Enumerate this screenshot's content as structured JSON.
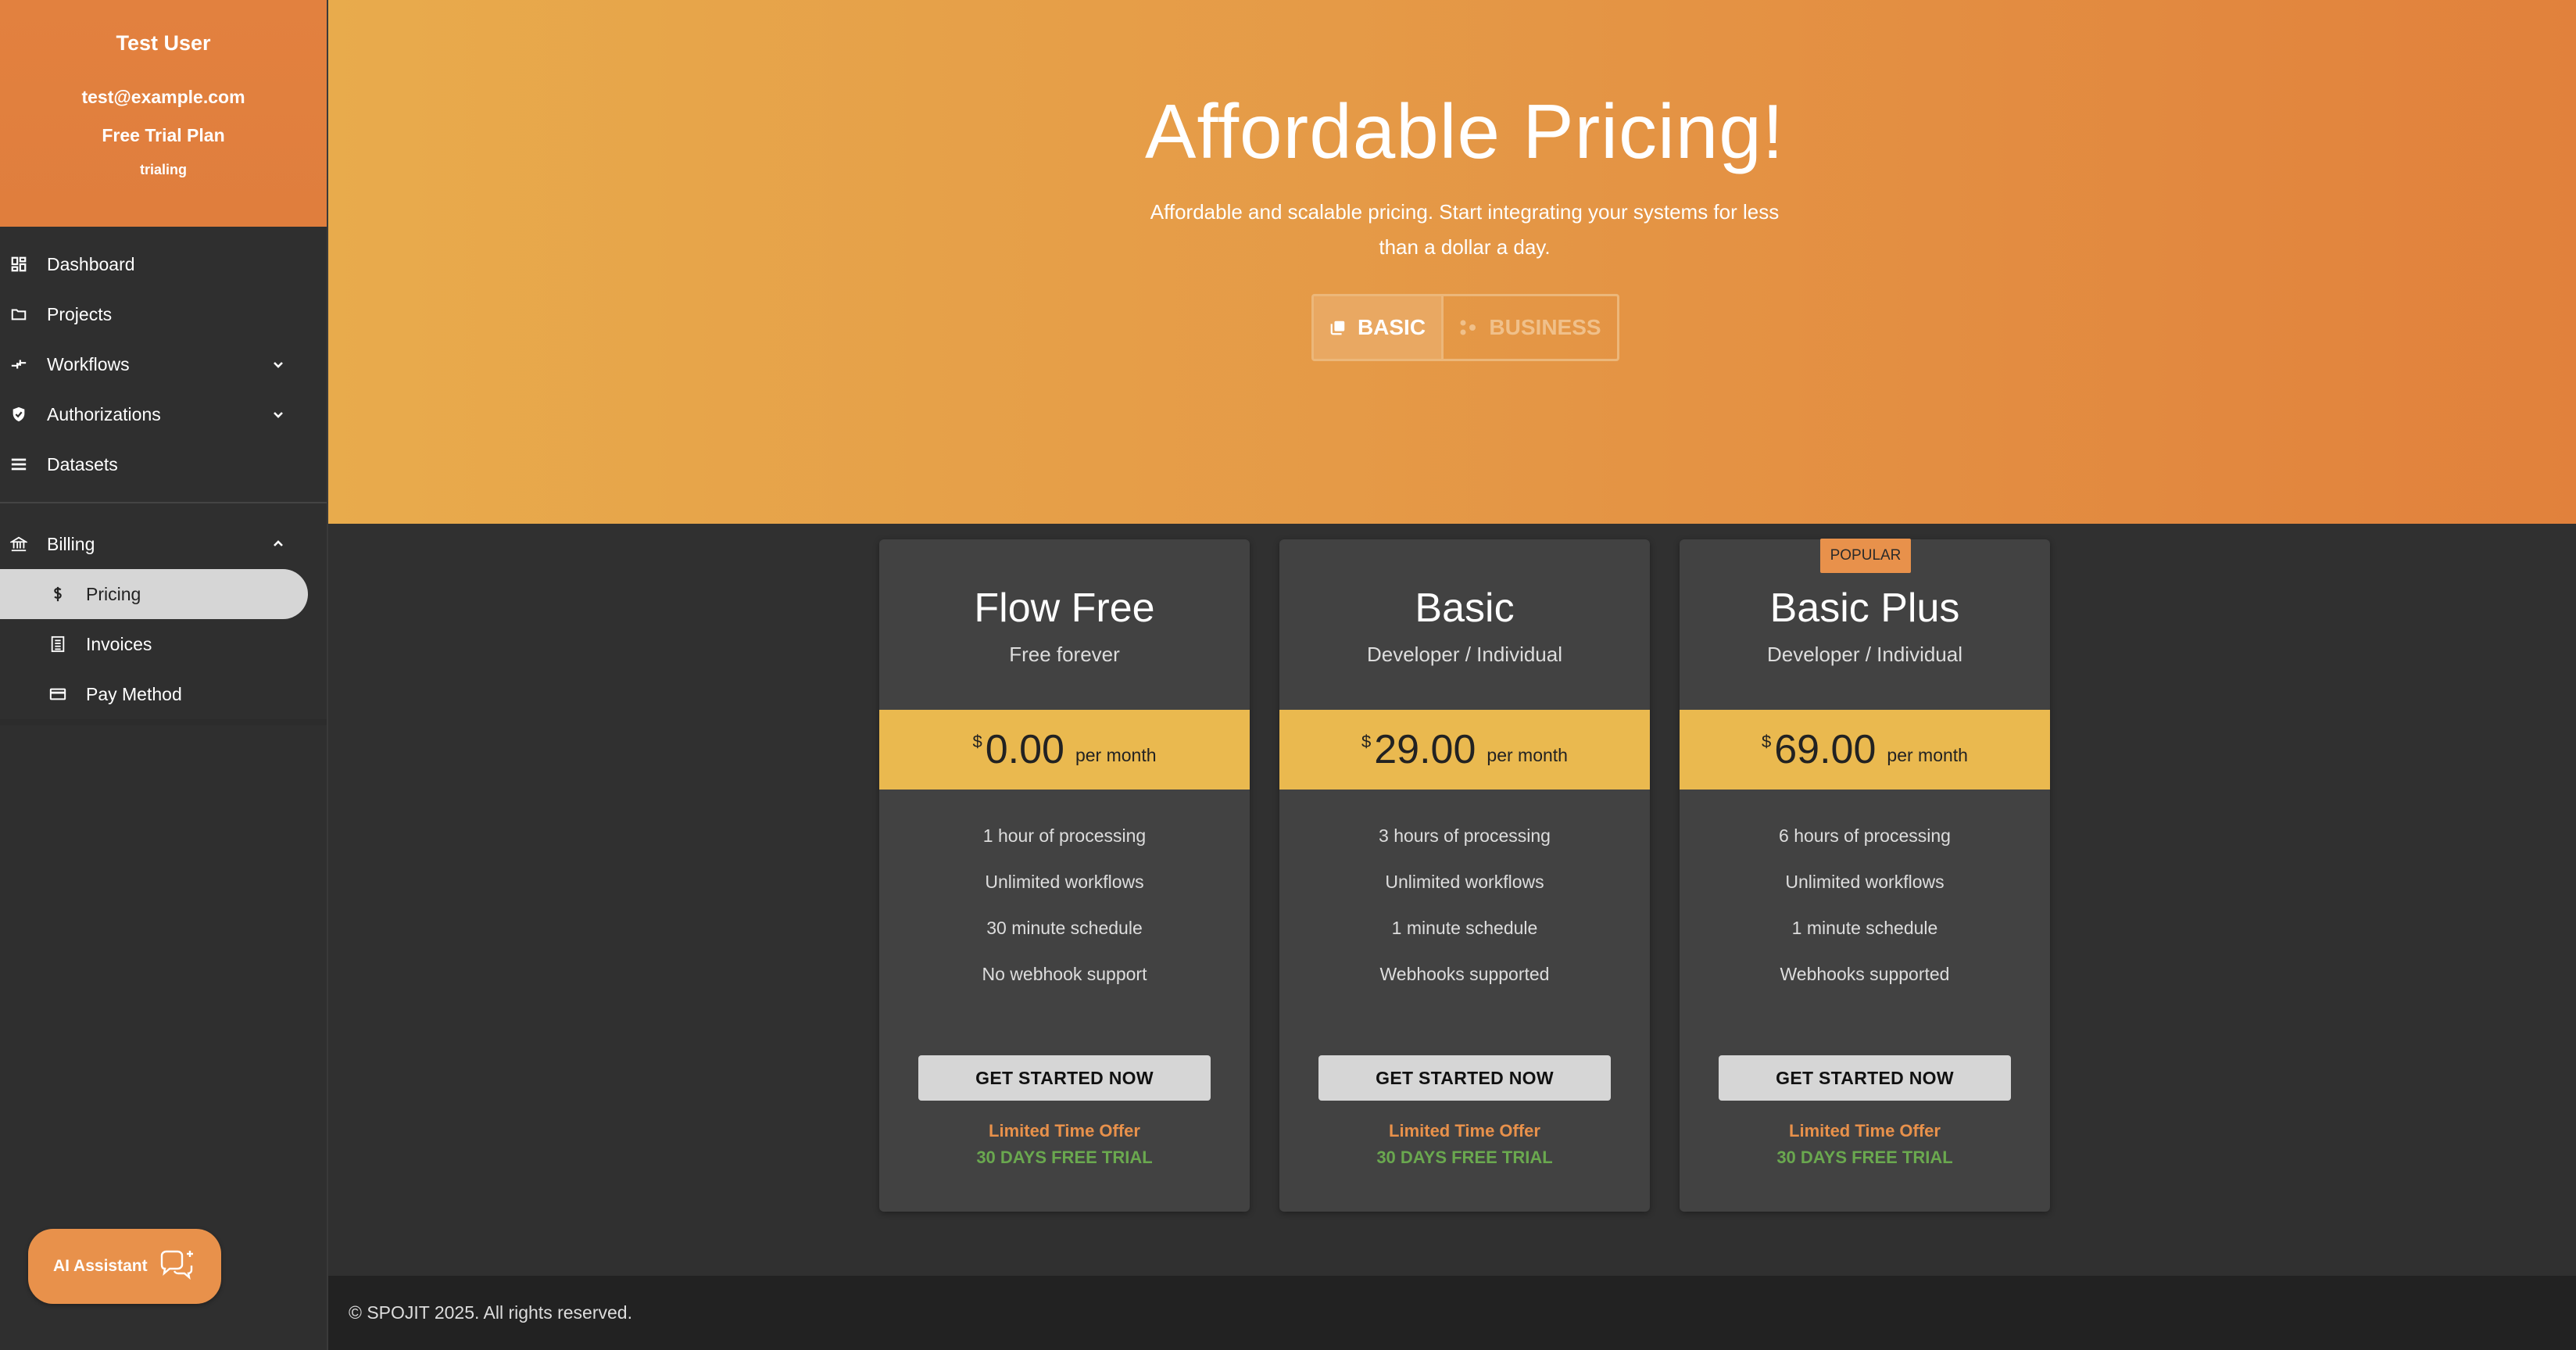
{
  "user": {
    "name": "Test User",
    "email": "test@example.com",
    "plan": "Free Trial Plan",
    "status": "trialing"
  },
  "nav": {
    "items": [
      {
        "label": "Dashboard",
        "icon": "dashboard-icon"
      },
      {
        "label": "Projects",
        "icon": "folder-icon"
      },
      {
        "label": "Workflows",
        "icon": "workflow-icon",
        "expandable": true
      },
      {
        "label": "Authorizations",
        "icon": "shield-icon",
        "expandable": true
      },
      {
        "label": "Datasets",
        "icon": "list-icon"
      }
    ],
    "billing": {
      "label": "Billing",
      "icon": "bank-icon",
      "sub": [
        {
          "label": "Pricing",
          "icon": "dollar-icon",
          "active": true
        },
        {
          "label": "Invoices",
          "icon": "receipt-icon"
        },
        {
          "label": "Pay Method",
          "icon": "credit-card-icon"
        }
      ]
    }
  },
  "ai_assistant": {
    "label": "AI Assistant",
    "icon": "chat-sparkle-icon"
  },
  "hero": {
    "title": "Affordable Pricing!",
    "subtitle": "Affordable and scalable pricing. Start integrating your systems for less than a dollar a day.",
    "toggle": {
      "basic": "BASIC",
      "business": "BUSINESS",
      "selected": "basic"
    }
  },
  "plans": [
    {
      "name": "Flow Free",
      "sub": "Free forever",
      "currency": "$",
      "price": "0.00",
      "period": "per month",
      "features": [
        "1 hour of processing",
        "Unlimited workflows",
        "30 minute schedule",
        "No webhook support"
      ],
      "cta": "GET STARTED NOW",
      "offer": "Limited Time Offer",
      "trial": "30 DAYS FREE TRIAL"
    },
    {
      "name": "Basic",
      "sub": "Developer / Individual",
      "currency": "$",
      "price": "29.00",
      "period": "per month",
      "features": [
        "3 hours of processing",
        "Unlimited workflows",
        "1 minute schedule",
        "Webhooks supported"
      ],
      "cta": "GET STARTED NOW",
      "offer": "Limited Time Offer",
      "trial": "30 DAYS FREE TRIAL"
    },
    {
      "name": "Basic Plus",
      "sub": "Developer / Individual",
      "badge": "POPULAR",
      "currency": "$",
      "price": "69.00",
      "period": "per month",
      "features": [
        "6 hours of processing",
        "Unlimited workflows",
        "1 minute schedule",
        "Webhooks supported"
      ],
      "cta": "GET STARTED NOW",
      "offer": "Limited Time Offer",
      "trial": "30 DAYS FREE TRIAL"
    }
  ],
  "footer": {
    "text": "© SPOJIT 2025. All rights reserved."
  },
  "colors": {
    "accent_orange": "#e8914b",
    "price_band": "#eab94f",
    "trial_green": "#6aa84f",
    "card_bg": "#424242",
    "page_bg": "#303030"
  }
}
